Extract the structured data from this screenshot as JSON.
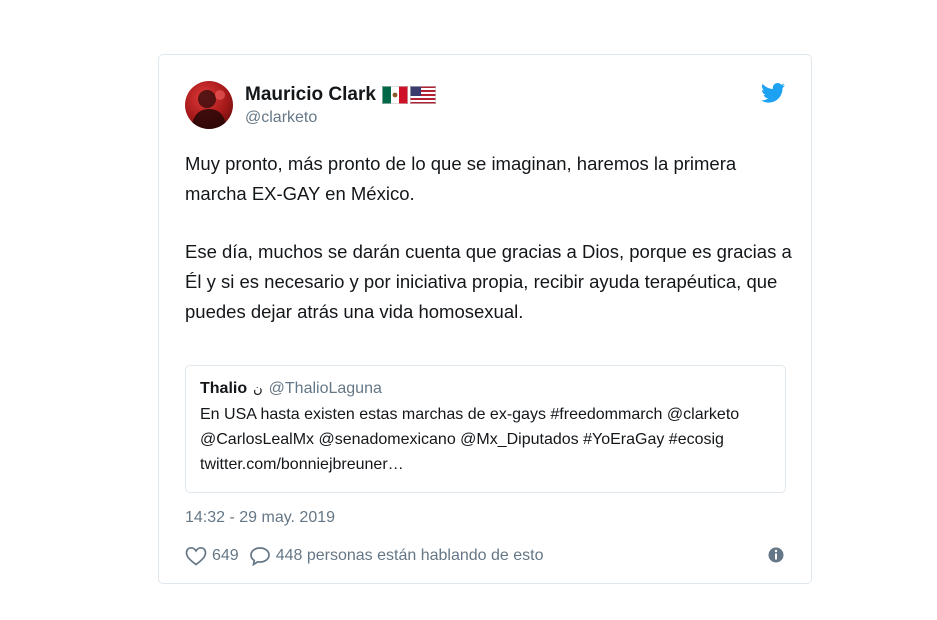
{
  "tweet": {
    "author": {
      "display_name": "Mauricio Clark",
      "handle": "@clarketo",
      "flags": [
        "mexico-flag",
        "usa-flag"
      ]
    },
    "paragraphs": [
      "Muy pronto, más pronto de lo que se imaginan, haremos la primera marcha EX-GAY en México.",
      "Ese día, muchos se darán cuenta que gracias a Dios, porque es gracias a Él y si es necesario y por iniciativa propia, recibir ayuda terapéutica, que puedes dejar atrás una vida homosexual."
    ],
    "quoted": {
      "display_name": "Thalio",
      "name_mark": "ن",
      "handle": "@ThalioLaguna",
      "text": "En USA hasta existen estas marchas de ex-gays #freedommarch @clarketo @CarlosLealMx @senadomexicano @Mx_Diputados #YoEraGay #ecosig twitter.com/bonniejbreuner…"
    },
    "timestamp": "14:32 - 29 may. 2019",
    "likes": "649",
    "conversation": "448 personas están hablando de esto"
  },
  "icons": {
    "brand": "twitter-bird-icon",
    "like": "heart-icon",
    "reply": "speech-bubble-icon",
    "info": "info-icon"
  },
  "colors": {
    "twitter_blue": "#1da1f2",
    "secondary_text": "#657786",
    "border": "#e1e8ed"
  }
}
